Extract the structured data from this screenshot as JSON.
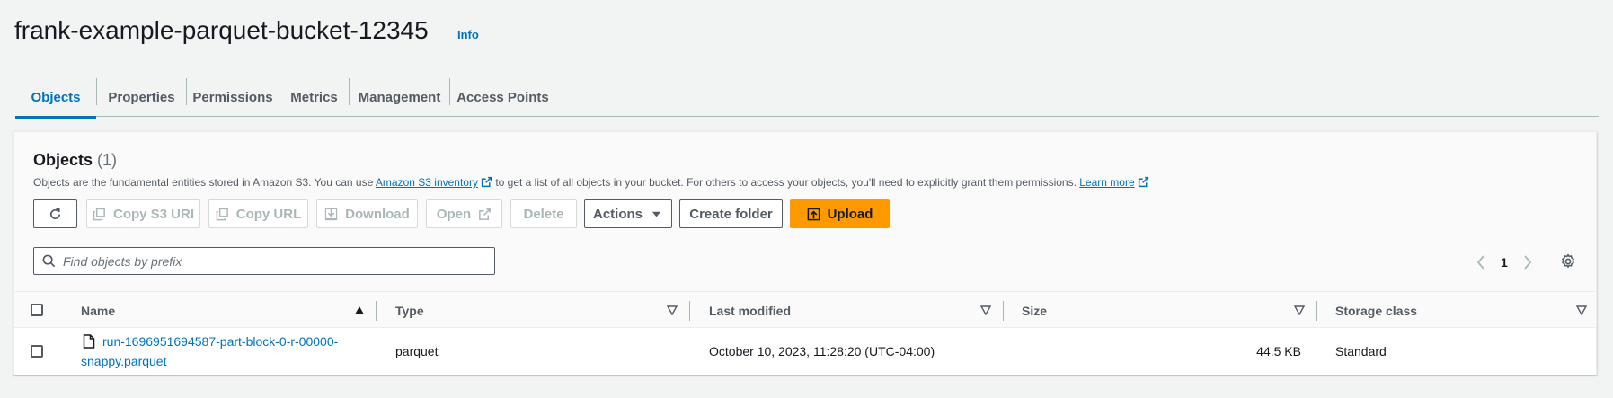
{
  "header": {
    "title": "frank-example-parquet-bucket-12345",
    "info_label": "Info"
  },
  "tabs": [
    {
      "label": "Objects",
      "active": true
    },
    {
      "label": "Properties",
      "active": false
    },
    {
      "label": "Permissions",
      "active": false
    },
    {
      "label": "Metrics",
      "active": false
    },
    {
      "label": "Management",
      "active": false
    },
    {
      "label": "Access Points",
      "active": false
    }
  ],
  "objects_panel": {
    "title": "Objects",
    "count": "(1)",
    "description_part1": "Objects are the fundamental entities stored in Amazon S3. You can use ",
    "inventory_link": "Amazon S3 inventory",
    "description_part2": " to get a list of all objects in your bucket. For others to access your objects, you'll need to explicitly grant them permissions. ",
    "learn_more_link": "Learn more"
  },
  "toolbar": {
    "refresh_icon": "refresh-icon",
    "copy_s3_uri": "Copy S3 URI",
    "copy_url": "Copy URL",
    "download": "Download",
    "open": "Open",
    "delete": "Delete",
    "actions": "Actions",
    "create_folder": "Create folder",
    "upload": "Upload"
  },
  "search": {
    "placeholder": "Find objects by prefix",
    "value": ""
  },
  "pagination": {
    "current_page": "1"
  },
  "table": {
    "columns": [
      "Name",
      "Type",
      "Last modified",
      "Size",
      "Storage class"
    ],
    "rows": [
      {
        "name_line1": "run-1696951694587-part-block-0-r-00000-",
        "name_line2": "snappy.parquet",
        "type": "parquet",
        "last_modified": "October 10, 2023, 11:28:20 (UTC-04:00)",
        "size": "44.5 KB",
        "storage_class": "Standard"
      }
    ]
  },
  "colors": {
    "accent": "#0073bb",
    "primary_button": "#ff9900",
    "background": "#f2f3f3"
  }
}
